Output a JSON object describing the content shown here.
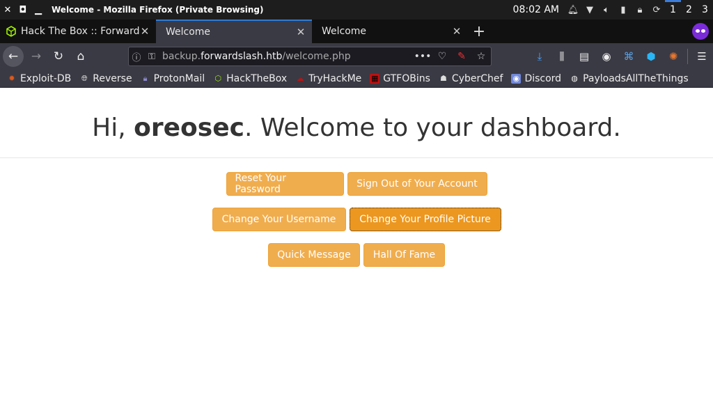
{
  "os": {
    "window_title": "Welcome - Mozilla Firefox (Private Browsing)",
    "clock": "08:02 AM",
    "workspaces": [
      "1",
      "2",
      "3"
    ]
  },
  "tabs": [
    {
      "label": "Hack The Box :: Forward",
      "icon": "htb-cube-icon"
    },
    {
      "label": "Welcome",
      "icon": ""
    },
    {
      "label": "Welcome",
      "icon": ""
    }
  ],
  "urlbar": {
    "prefix": "backup.",
    "host": "forwardslash.htb",
    "path": "/welcome.php"
  },
  "bookmarks": [
    {
      "label": "Exploit-DB",
      "icon": "exploitdb-icon",
      "color": "#e05a1c"
    },
    {
      "label": "Reverse",
      "icon": "globe-icon",
      "color": "#dddddd"
    },
    {
      "label": "ProtonMail",
      "icon": "protonmail-icon",
      "color": "#8b89cc"
    },
    {
      "label": "HackTheBox",
      "icon": "htb-cube-icon",
      "color": "#9fef00"
    },
    {
      "label": "TryHackMe",
      "icon": "tryhackme-icon",
      "color": "#c11111"
    },
    {
      "label": "GTFOBins",
      "icon": "gtfobins-icon",
      "color": "#c11111"
    },
    {
      "label": "CyberChef",
      "icon": "cyberchef-icon",
      "color": "#dddddd"
    },
    {
      "label": "Discord",
      "icon": "discord-icon",
      "color": "#7289da"
    },
    {
      "label": "PayloadsAllTheThings",
      "icon": "github-icon",
      "color": "#eeeeee"
    }
  ],
  "page": {
    "greeting": "Hi, ",
    "username": "oreosec",
    "greeting_suffix": ". Welcome to your dashboard.",
    "buttons": {
      "reset_password": "Reset Your Password",
      "sign_out": "Sign Out of Your Account",
      "change_username": "Change Your Username",
      "change_picture": "Change Your Profile Picture",
      "quick_message": "Quick Message",
      "hall_of_fame": "Hall Of Fame"
    }
  },
  "colors": {
    "button_warning": "#f0ad4e",
    "button_focus": "#ec971f",
    "tab_accent": "#2f7bd6"
  }
}
